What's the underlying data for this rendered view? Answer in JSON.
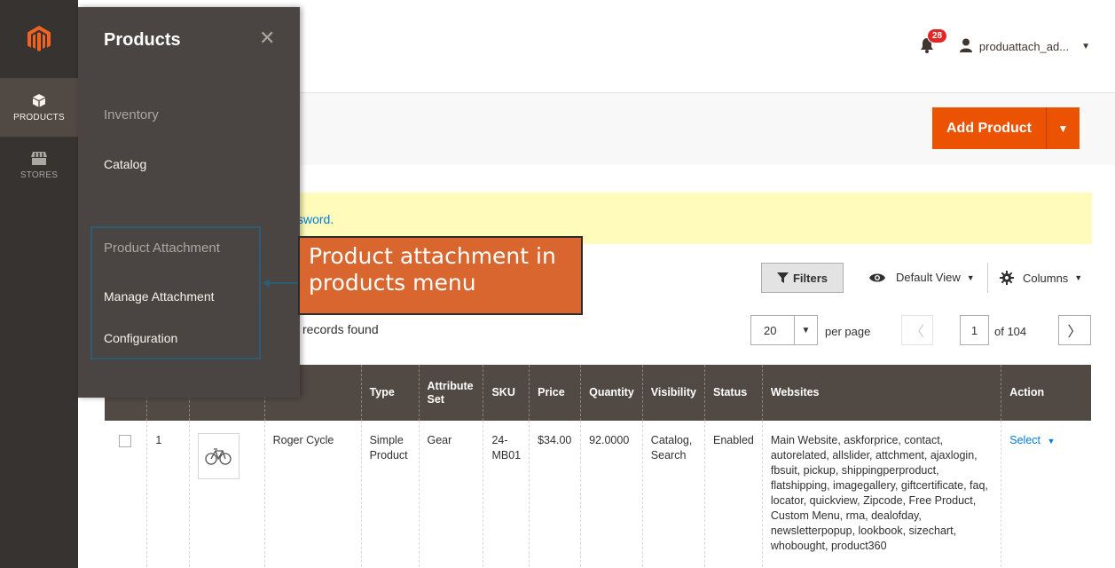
{
  "header": {
    "notification_count": "28",
    "user_name": "produattach_ad..."
  },
  "nav": {
    "items": [
      {
        "label": "PRODUCTS",
        "icon": "box-icon"
      },
      {
        "label": "STORES",
        "icon": "store-icon"
      }
    ]
  },
  "flyout": {
    "title": "Products",
    "sections": [
      {
        "heading": "Inventory",
        "links": [
          "Catalog"
        ]
      },
      {
        "heading": "Product Attachment",
        "links": [
          "Manage Attachment",
          "Configuration"
        ]
      }
    ]
  },
  "page": {
    "add_product_label": "Add Product",
    "message_text": "sword."
  },
  "callout": {
    "text": "Product attachment in products menu"
  },
  "toolbar": {
    "filters_label": "Filters",
    "view_label": "Default View",
    "columns_label": "Columns",
    "records_text": "records found",
    "per_page_value": "20",
    "per_page_label": "per page",
    "current_page": "1",
    "total_pages": "of 104"
  },
  "table": {
    "headers": [
      "",
      "",
      "",
      "e",
      "Type",
      "Attribute Set",
      "SKU",
      "Price",
      "Quantity",
      "Visibility",
      "Status",
      "Websites",
      "Action"
    ],
    "rows": [
      {
        "id": "1",
        "name": "Roger Cycle",
        "type": "Simple Product",
        "attribute_set": "Gear",
        "sku": "24-MB01",
        "price": "$34.00",
        "quantity": "92.0000",
        "visibility": "Catalog, Search",
        "status": "Enabled",
        "websites": "Main Website, askforprice, contact, autorelated, allslider, attchment, ajaxlogin, fbsuit, pickup, shippingperproduct, flatshipping, imagegallery, giftcertificate, faq, locator, quickview, Zipcode, Free Product, Custom Menu, rma, dealofday, newsletterpopup, lookbook, sizechart, whobought, product360",
        "action": "Select"
      }
    ]
  },
  "colors": {
    "accent": "#eb5202",
    "nav_bg": "#373330",
    "header_row": "#514943",
    "callout": "#d8662e"
  }
}
